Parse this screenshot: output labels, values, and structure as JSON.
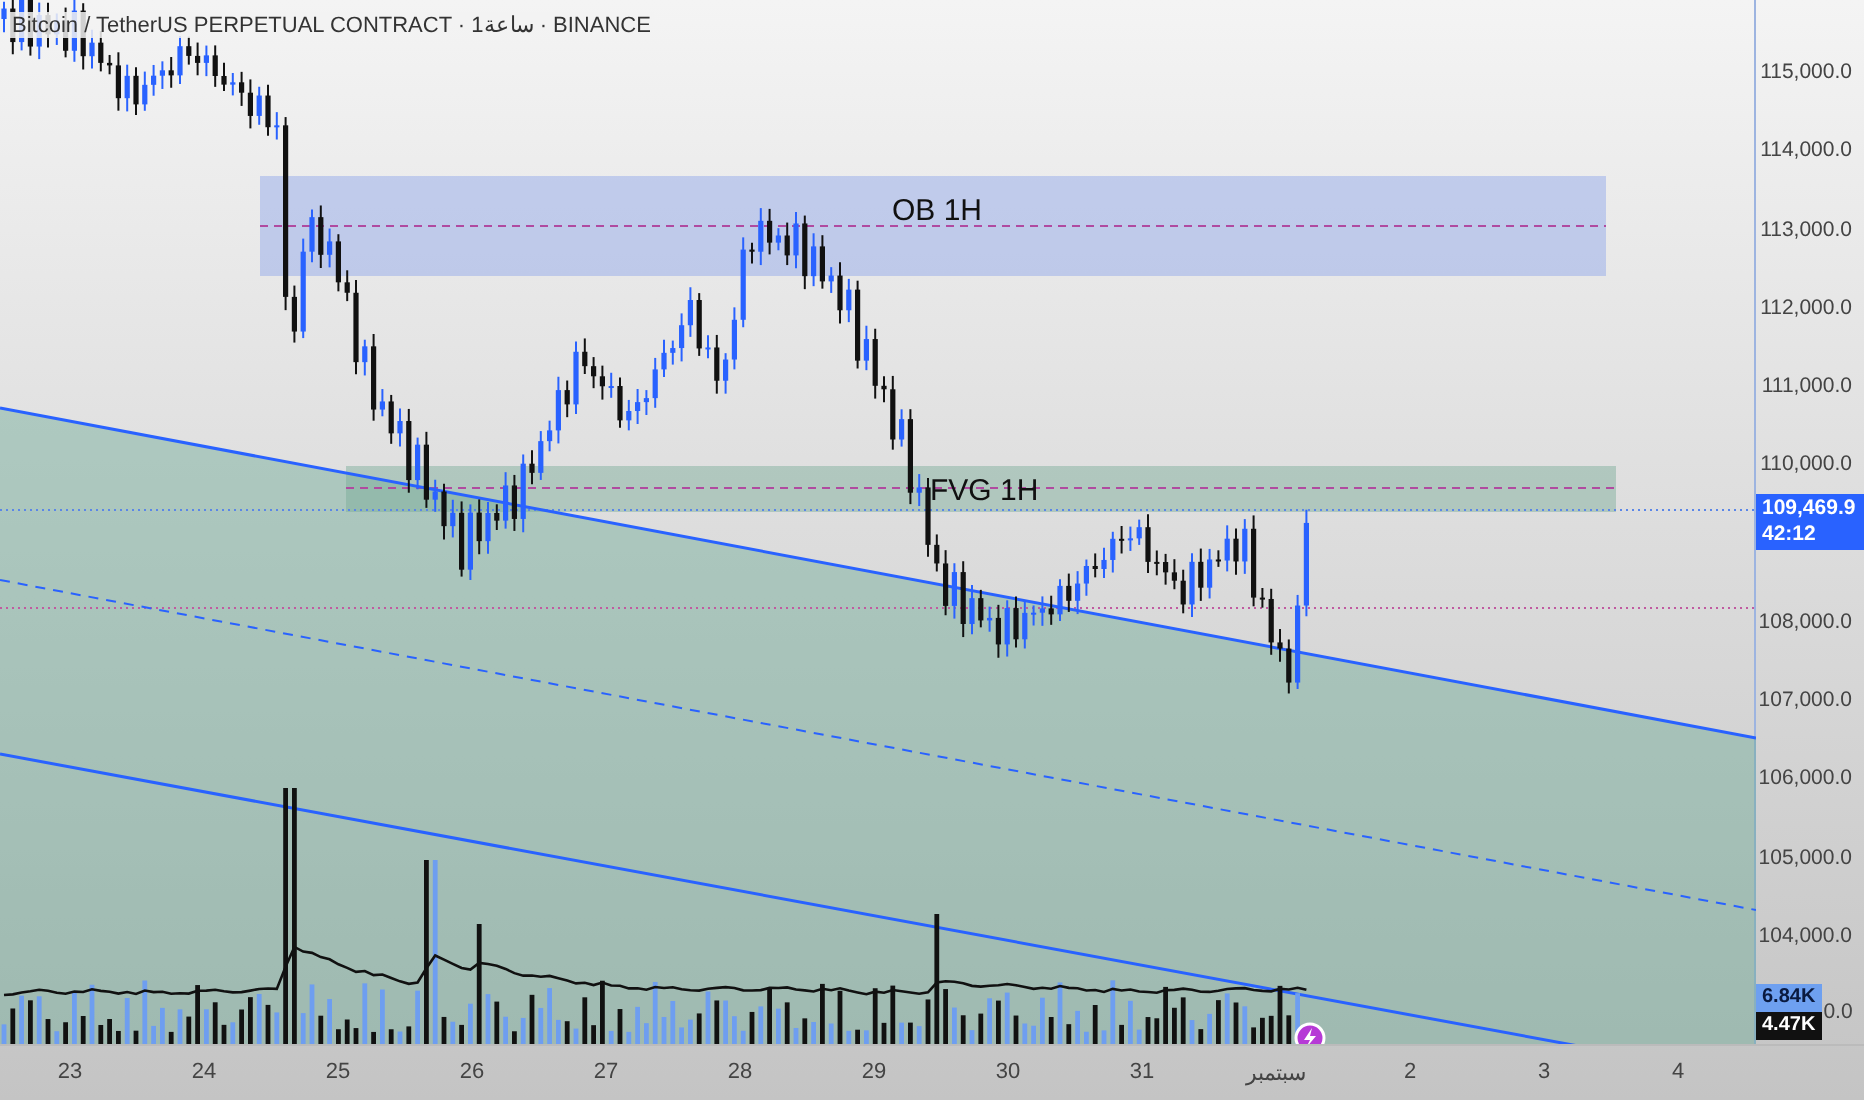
{
  "header": {
    "title": "Bitcoin / TetherUS PERPETUAL CONTRACT · 1ساعة · BINANCE"
  },
  "zones": [
    {
      "label": "OB 1H",
      "kind": "order-block"
    },
    {
      "label": "FVG 1H",
      "kind": "fair-value-gap"
    }
  ],
  "price_axis": {
    "labels": [
      "115,000.0",
      "114,000.0",
      "113,000.0",
      "112,000.0",
      "111,000.0",
      "110,000.0",
      "108,000.0",
      "107,000.0",
      "106,000.0",
      "105,000.0",
      "104,000.0"
    ],
    "partial_label": "0.0"
  },
  "last_price": {
    "value": "109,469.9",
    "countdown": "42:12"
  },
  "volume_badges": [
    {
      "text": "6.84K",
      "kind": "volume"
    },
    {
      "text": "4.47K",
      "kind": "average"
    }
  ],
  "time_axis": {
    "labels": [
      "23",
      "24",
      "25",
      "26",
      "27",
      "28",
      "29",
      "30",
      "31",
      "سبتمبر",
      "2",
      "3",
      "4"
    ]
  }
}
